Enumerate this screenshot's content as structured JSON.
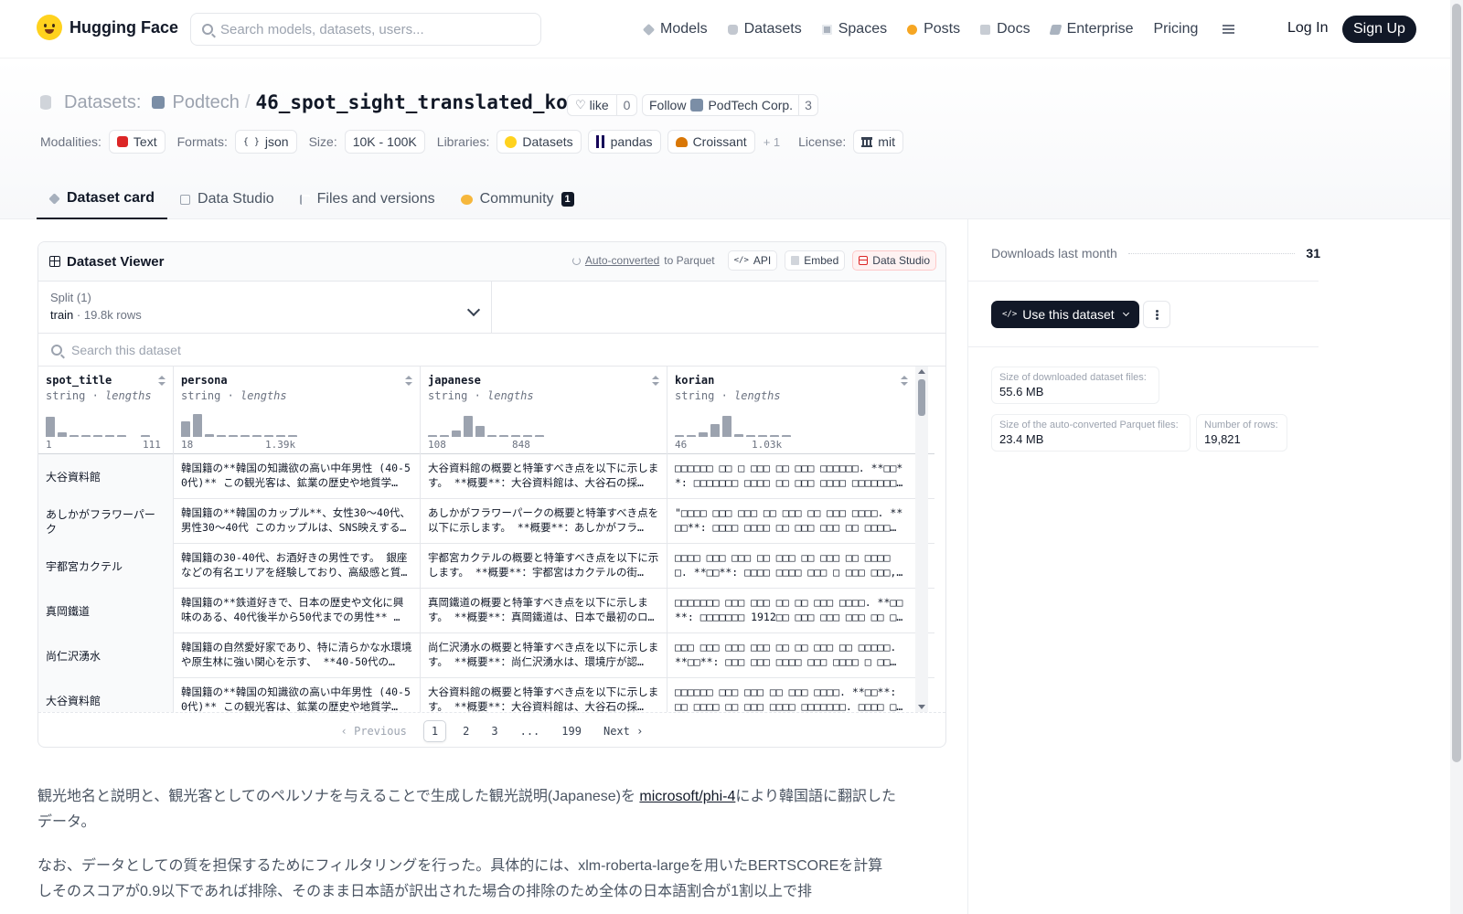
{
  "nav": {
    "brand": "Hugging Face",
    "search_placeholder": "Search models, datasets, users...",
    "links": [
      "Models",
      "Datasets",
      "Spaces",
      "Posts",
      "Docs",
      "Enterprise",
      "Pricing"
    ],
    "login": "Log In",
    "signup": "Sign Up"
  },
  "header": {
    "section": "Datasets:",
    "owner": "Podtech",
    "separator": "/",
    "repo": "46_spot_sight_translated_ko",
    "like_label": "like",
    "like_count": "0",
    "follow_label": "Follow",
    "follow_org": "PodTech Corp.",
    "follow_count": "3"
  },
  "meta": {
    "modalities_label": "Modalities:",
    "modality": "Text",
    "formats_label": "Formats:",
    "format": "json",
    "size_label": "Size:",
    "size": "10K - 100K",
    "libraries_label": "Libraries:",
    "libraries": [
      "Datasets",
      "pandas",
      "Croissant"
    ],
    "libraries_more": "+ 1",
    "license_label": "License:",
    "license": "mit"
  },
  "tabs": {
    "card": "Dataset card",
    "studio": "Data Studio",
    "files": "Files and versions",
    "community": "Community",
    "community_badge": "1"
  },
  "viewer": {
    "title": "Dataset Viewer",
    "autoconv_link": "Auto-converted",
    "autoconv_text": "to Parquet",
    "api": "API",
    "embed": "Embed",
    "studio": "Data Studio",
    "split_label": "Split (1)",
    "split_name": "train",
    "split_dot": "·",
    "split_rows": "19.8k rows",
    "search_placeholder": "Search this dataset",
    "columns": [
      {
        "name": "spot_title",
        "type": "string",
        "sub": "lengths",
        "min": "1",
        "max": "111",
        "bars": [
          0.85,
          0.2,
          0.06,
          0.06,
          0.06,
          0.06,
          0.06,
          0,
          0.06
        ]
      },
      {
        "name": "persona",
        "type": "string",
        "sub": "lengths",
        "min": "18",
        "max": "1.39k",
        "bars": [
          0.65,
          0.95,
          0.1,
          0.06,
          0.06,
          0.06,
          0.06,
          0.06,
          0.06,
          0.06
        ]
      },
      {
        "name": "japanese",
        "type": "string",
        "sub": "lengths",
        "min": "108",
        "max": "848",
        "bars": [
          0.06,
          0.06,
          0.25,
          0.9,
          0.45,
          0.06,
          0.06,
          0.06,
          0.06,
          0.06
        ]
      },
      {
        "name": "korian",
        "type": "string",
        "sub": "lengths",
        "min": "46",
        "max": "1.03k",
        "bars": [
          0.06,
          0.06,
          0.2,
          0.55,
          0.9,
          0.1,
          0.06,
          0.06,
          0.06,
          0.06
        ]
      }
    ],
    "rows": [
      [
        "大谷資料館",
        "韓国籍の**韓国の知識欲の高い中年男性 (40-50代)** この観光客は、鉱業の歴史や地質学…",
        "大谷資料館の概要と特筆すべき点を以下に示します。 **概要**：大谷資料館は、大谷石の採…",
        "□□□□□□ □□ □ □□□ □□ □□□ □□□□□□. **□□**: □□□□□□□ □□□□ □□ □□□ □□□□ □□□□□□□. □□□□…"
      ],
      [
        "あしかがフラワーパーク",
        "韓国籍の**韓国のカップル**、女性30〜40代、男性30〜40代 このカップルは、SNS映えする…",
        "あしかがフラワーパークの概要と特筆すべき点を以下に示します。 **概要**：あしかがフラ…",
        "\"□□□□ □□□ □□□ □□ □□□ □□ □□□ □□□□. **□□**: □□□□ □□□□ □□ □□□ □□□ □□ □□□□ □…"
      ],
      [
        "宇都宮カクテル",
        "韓国籍の30-40代、お酒好きの男性です。 銀座などの有名エリアを経験しており、高級感と質…",
        "宇都宮カクテルの概要と特筆すべき点を以下に示します。 **概要**：宇都宮はカクテルの街…",
        "□□□□ □□□ □□□ □□ □□□ □□ □□□ □□ □□□□ □. **□□**: □□□□ □□□□ □□□ □ □□□ □□□, …"
      ],
      [
        "真岡鐵道",
        "韓国籍の**鉄道好きで、日本の歴史や文化に興味のある、40代後半から50代までの男性** …",
        "真岡鐵道の概要と特筆すべき点を以下に示します。 **概要**：真岡鐵道は、日本で最初のロ…",
        "□□□□□□□ □□□ □□□ □□ □□ □□□ □□□□. **□□**: □□□□□□□ 1912□□ □□□ □□□ □□□ □□ □□□…"
      ],
      [
        "尚仁沢湧水",
        "韓国籍の自然愛好家であり、特に清らかな水環境や原生林に強い関心を示す、 **40-50代の…",
        "尚仁沢湧水の概要と特筆すべき点を以下に示します。 **概要**：尚仁沢湧水は、環境庁が認…",
        "□□□ □□□ □□□ □□□ □□ □□ □□□ □□ □□□□□. **□□**: □□□ □□□ □□□□ □□□ □□□□ □ □□□,…"
      ],
      [
        "大谷資料館",
        "韓国籍の**韓国の知識欲の高い中年男性 (40-50代)** この観光客は、鉱業の歴史や地質学…",
        "大谷資料館の概要と特筆すべき点を以下に示します。 **概要**：大谷資料館は、大谷石の採…",
        "□□□□□□ □□□ □□□ □□ □□□ □□□□. **□□**: □□ □□□□ □□ □□□ □□□□ □□□□□□□. □□□□ □□…"
      ]
    ],
    "pager": {
      "prev": "Previous",
      "pages": [
        "1",
        "2",
        "3",
        "...",
        "199"
      ],
      "next": "Next"
    }
  },
  "description": {
    "p1_before": "観光地名と説明と、観光客としてのペルソナを与えることで生成した観光説明(Japanese)を",
    "p1_link": "microsoft/phi-4",
    "p1_after": "により韓国語に翻訳したデータ。",
    "p2": "なお、データとしての質を担保するためにフィルタリングを行った。具体的には、xlm-roberta-largeを用いたBERTSCOREを計算しそのスコアが0.9以下であれば排除、そのまま日本語が訳出された場合の排除のため全体の日本語割合が1割以上で排"
  },
  "sidebar": {
    "downloads_label": "Downloads last month",
    "downloads": "31",
    "use_button": "Use this dataset",
    "stats": [
      {
        "label": "Size of downloaded dataset files:",
        "value": "55.6 MB"
      },
      {
        "label": "Size of the auto-converted Parquet files:",
        "value": "23.4 MB"
      },
      {
        "label": "Number of rows:",
        "value": "19,821"
      }
    ]
  }
}
